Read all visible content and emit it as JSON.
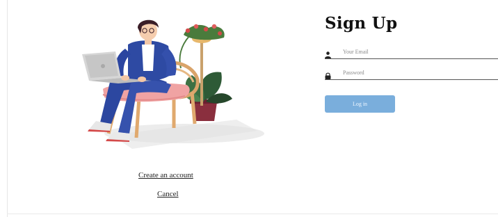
{
  "signup": {
    "title": "Sign Up",
    "email_placeholder": "Your Email",
    "password_placeholder": "Password",
    "login_label": "Log in"
  },
  "links": {
    "create_account": "Create an account",
    "cancel": "Cancel"
  },
  "colors": {
    "button": "#7aaedc",
    "jacket": "#2e4aa3"
  },
  "icons": {
    "email_field": "person-icon",
    "password_field": "lock-icon"
  }
}
